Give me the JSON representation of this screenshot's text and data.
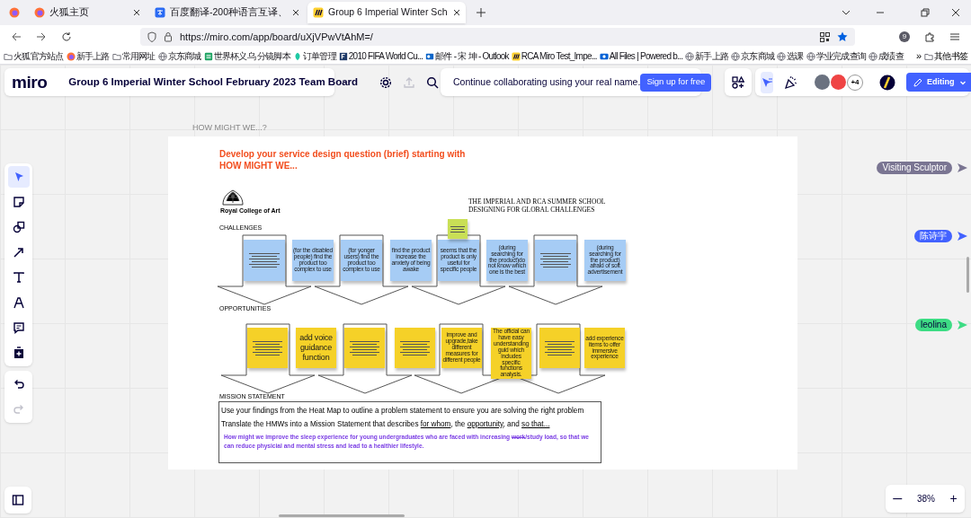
{
  "browser": {
    "tabs": [
      {
        "title": "火狐主页",
        "selected": false
      },
      {
        "title": "百度翻译-200种语言互译、",
        "selected": false
      },
      {
        "title": "Group 6 Imperial Winter Sch",
        "selected": true
      }
    ],
    "url": "https://miro.com/app/board/uXjVPwVtAhM=/",
    "extensions_badge": "9",
    "bookmarks": [
      "火狐官方站点",
      "新手上路",
      "常用网址",
      "京东商城",
      "世界杯义乌 分镜脚本",
      "订单管理",
      "2010 FIFA World Cu...",
      "邮件 - 宋 坤 - Outlook",
      "RCA Miro Test_Impe...",
      "All Files | Powered b...",
      "新手上路",
      "京东商城",
      "选课",
      "学业完成查询",
      "成绩查"
    ],
    "more": "»",
    "other_bookmarks": "其他书签"
  },
  "miro": {
    "logo": "miro",
    "board_title": "Group 6 Imperial Winter School February 2023 Team Board",
    "upload_disabled": true,
    "banner": {
      "text": "Continue collaborating using your real name.",
      "button": "Sign up for free"
    },
    "cursor_mode_selected": true,
    "avatars": [
      {
        "color": "#6b7280"
      },
      {
        "color": "#ef4444"
      }
    ],
    "more_avatars": "+4",
    "editing_button": "Editing",
    "tools": [
      {
        "kind": "select",
        "selected": true
      },
      {
        "kind": "sticky",
        "selected": false
      },
      {
        "kind": "shapes",
        "selected": false
      },
      {
        "kind": "line",
        "selected": false
      },
      {
        "kind": "text",
        "selected": false
      },
      {
        "kind": "pen",
        "selected": false
      },
      {
        "kind": "comment",
        "selected": false
      },
      {
        "kind": "add",
        "selected": false
      }
    ],
    "history": [
      {
        "kind": "undo",
        "disabled": false
      },
      {
        "kind": "redo",
        "disabled": true
      }
    ],
    "collaborators": [
      {
        "name": "Visiting Sculptor",
        "color": "#7a7592"
      },
      {
        "name": "陈诗宇",
        "color": "#4262ff"
      },
      {
        "name": "leolina",
        "color": "#3ddc84"
      }
    ],
    "zoom": {
      "minus": "—",
      "level": "38%",
      "plus": "+"
    }
  },
  "frame": {
    "name": "HOW MIGHT WE...?",
    "heading": [
      "Develop your service design question (brief) starting with",
      "HOW MIGHT WE..."
    ],
    "logo_text": "Royal College of Art",
    "school": [
      "THE IMPERIAL AND RCA SUMMER SCHOOL",
      "DESIGNING FOR GLOBAL CHALLENGES"
    ],
    "challenges_label": "CHALLENGES",
    "challenges": [
      {
        "kind": "scribble"
      },
      {
        "kind": "text",
        "text": "(for the disabled people) find the product too complex to use"
      },
      {
        "kind": "text",
        "text": "(for yonger users) find the product too complex to use"
      },
      {
        "kind": "text",
        "text": "find the product increase the anxiety of being awake"
      },
      {
        "kind": "text",
        "text": "seems that the product is only useful for specific people"
      },
      {
        "kind": "text",
        "text": "(during searching for the product)do not know which one is the best"
      },
      {
        "kind": "scribble"
      },
      {
        "kind": "text",
        "text": "(during searching for the product) afraid of soft advertisement"
      }
    ],
    "extra_note": {
      "kind": "scribble"
    },
    "opportunities_label": "OPPORTUNITIES",
    "opportunities": [
      {
        "kind": "scribble"
      },
      {
        "kind": "text",
        "text": "add voice guidance function"
      },
      {
        "kind": "scribble"
      },
      {
        "kind": "scribble"
      },
      {
        "kind": "text",
        "text": "improve and upgrade,take different measures for different people"
      },
      {
        "kind": "text",
        "text": "The official can have easy understanding guid which includes specific functions analysis."
      },
      {
        "kind": "scribble"
      },
      {
        "kind": "text",
        "text": "add experience items to offer immersive experience"
      }
    ],
    "mission_label": "MISSION STATEMENT",
    "mission_lines": [
      [
        {
          "text": "Use your findings from the Heat Map to outline a problem statement to ensure you are solving the right problem",
          "kind": "plain"
        }
      ],
      [
        {
          "text": "Translate the HMWs into a Mission Statement that describes ",
          "kind": "plain"
        },
        {
          "text": "for whom",
          "kind": "underline"
        },
        {
          "text": ", the ",
          "kind": "plain"
        },
        {
          "text": "opportunity",
          "kind": "underline"
        },
        {
          "text": ", and ",
          "kind": "plain"
        },
        {
          "text": "so that...",
          "kind": "underline"
        }
      ]
    ],
    "statement": [
      {
        "text": "How might we improve the sleep experience for young undergraduates who are faced with increasing ",
        "kind": "plain"
      },
      {
        "text": "work",
        "kind": "strike"
      },
      {
        "text": "/study load, so that we can reduce physicial and mental stress and lead to a healthier lifestyle.",
        "kind": "plain"
      }
    ]
  }
}
